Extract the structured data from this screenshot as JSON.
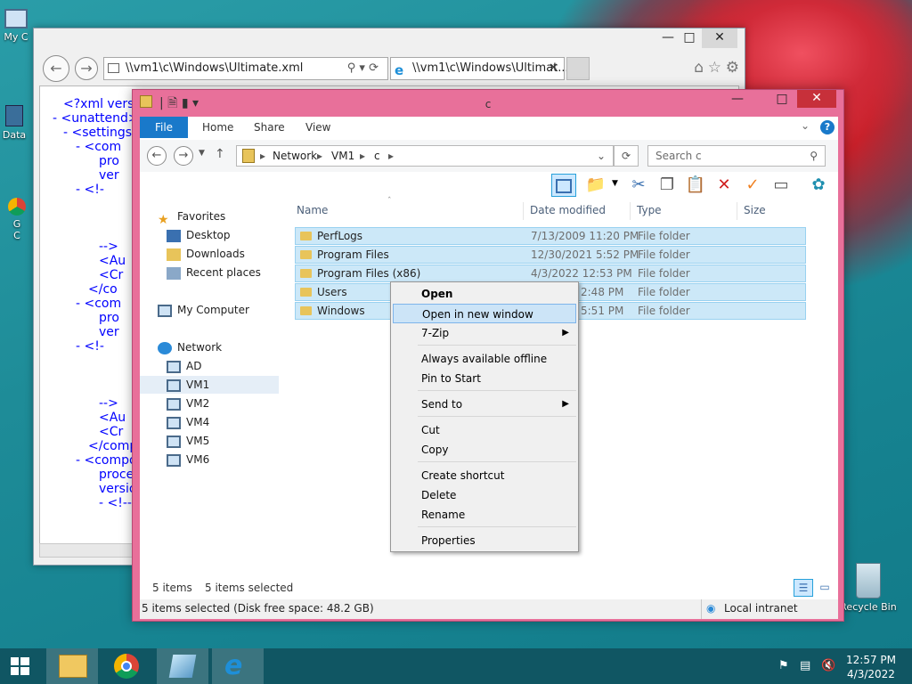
{
  "desktop": {
    "icons": [
      {
        "label": "My C",
        "icon": "computer-icon"
      },
      {
        "label": "Data",
        "icon": "data-icon"
      },
      {
        "label": "G\nC",
        "icon": "chrome-desktop-icon"
      },
      {
        "label": "Recycle Bin",
        "icon": "recycle-bin-icon"
      }
    ]
  },
  "ie": {
    "address": "\\\\vm1\\c\\Windows\\Ultimate.xml",
    "tab_title": "\\\\vm1\\c\\Windows\\Ultimat...",
    "xml_lines": [
      "<?xml versio",
      "- <unattend>",
      "- <settings",
      "- <com",
      "pro",
      "ver",
      "- <!-",
      "-->",
      "<Au",
      "<Cr",
      "</co",
      "- <com",
      "pro",
      "ver",
      "- <!-",
      "-->",
      "<Au",
      "<Cr",
      "</compo",
      "- <compo",
      "proces",
      "versio",
      "- <!--"
    ]
  },
  "explorer": {
    "title": "c",
    "ribbon_tabs": [
      "File",
      "Home",
      "Share",
      "View"
    ],
    "breadcrumb": [
      "Network",
      "VM1",
      "c"
    ],
    "search_placeholder": "Search c",
    "columns": {
      "name": "Name",
      "date": "Date modified",
      "type": "Type",
      "size": "Size"
    },
    "files": [
      {
        "name": "PerfLogs",
        "date": "7/13/2009 11:20 PM",
        "type": "File folder"
      },
      {
        "name": "Program Files",
        "date": "12/30/2021 5:52 PM",
        "type": "File folder"
      },
      {
        "name": "Program Files (x86)",
        "date": "4/3/2022 12:53 PM",
        "type": "File folder"
      },
      {
        "name": "Users",
        "date": "2:48 PM",
        "type": "File folder"
      },
      {
        "name": "Windows",
        "date": "5:51 PM",
        "type": "File folder"
      }
    ],
    "nav": {
      "favorites": "Favorites",
      "desktop": "Desktop",
      "downloads": "Downloads",
      "recent": "Recent places",
      "my_computer": "My Computer",
      "network": "Network",
      "computers": [
        "AD",
        "VM1",
        "VM2",
        "VM4",
        "VM5",
        "VM6"
      ]
    },
    "status": {
      "count": "5 items",
      "selected": "5 items selected",
      "details": "5 items selected (Disk free space: 48.2 GB)",
      "zone": "Local intranet"
    }
  },
  "context_menu": {
    "items": [
      "Open",
      "Open in new window",
      "7-Zip",
      "Always available offline",
      "Pin to Start",
      "Send to",
      "Cut",
      "Copy",
      "Create shortcut",
      "Delete",
      "Rename",
      "Properties"
    ]
  },
  "taskbar": {
    "time": "12:57 PM",
    "date": "4/3/2022"
  }
}
